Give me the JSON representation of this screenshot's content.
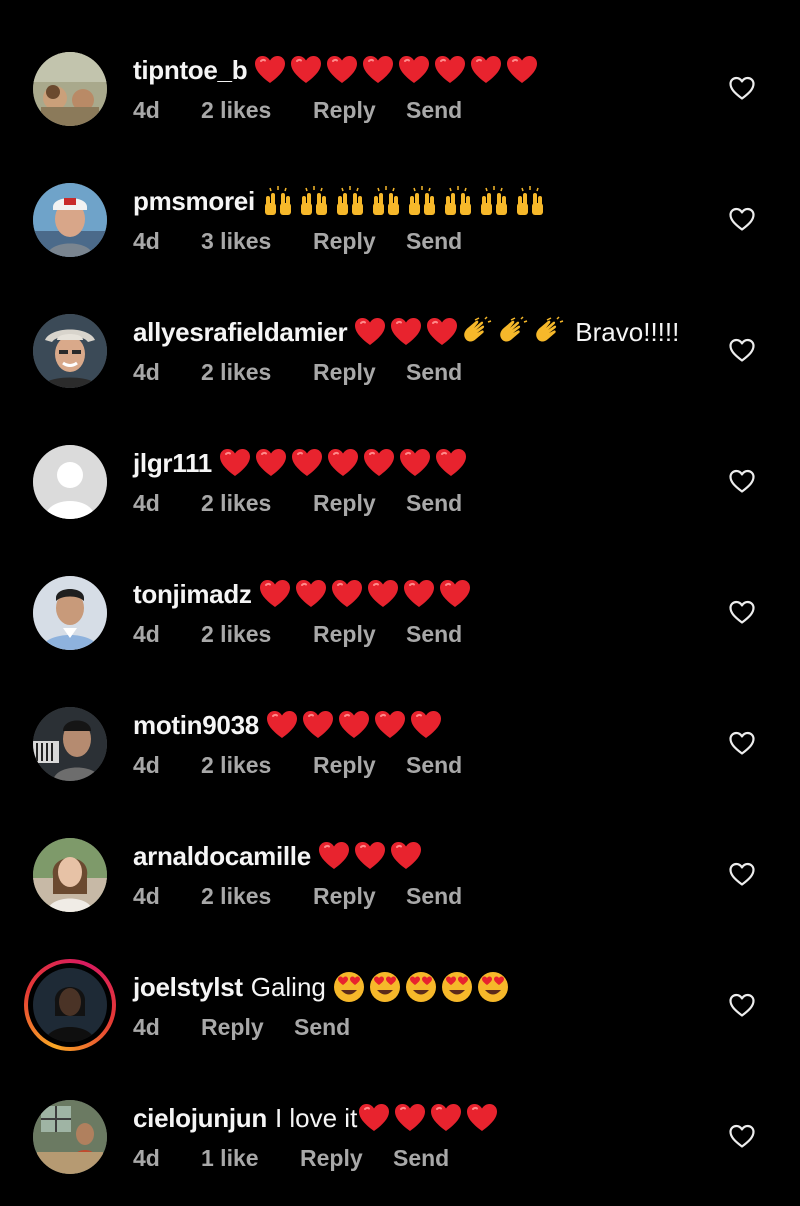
{
  "comments": [
    {
      "username": "tipntoe_b",
      "text": "",
      "emojis": [
        "heart",
        "heart",
        "heart",
        "heart",
        "heart",
        "heart",
        "heart",
        "heart"
      ],
      "trailing": "",
      "time": "4d",
      "likes": "2 likes",
      "reply": "Reply",
      "send": "Send",
      "avatar": "painting"
    },
    {
      "username": "pmsmorei",
      "text": "",
      "emojis": [
        "raising-hands",
        "raising-hands",
        "raising-hands",
        "raising-hands",
        "raising-hands",
        "raising-hands",
        "raising-hands",
        "raising-hands"
      ],
      "trailing": "",
      "time": "4d",
      "likes": "3 likes",
      "reply": "Reply",
      "send": "Send",
      "avatar": "cap-man"
    },
    {
      "username": "allyesrafieldamier",
      "text": "",
      "emojis": [
        "heart",
        "heart",
        "heart",
        "clapping-hands",
        "clapping-hands",
        "clapping-hands"
      ],
      "trailing": "Bravo!!!!!",
      "time": "4d",
      "likes": "2 likes",
      "reply": "Reply",
      "send": "Send",
      "avatar": "hat-man"
    },
    {
      "username": "jlgr111",
      "text": "",
      "emojis": [
        "heart",
        "heart",
        "heart",
        "heart",
        "heart",
        "heart",
        "heart"
      ],
      "trailing": "",
      "time": "4d",
      "likes": "2 likes",
      "reply": "Reply",
      "send": "Send",
      "avatar": "default"
    },
    {
      "username": "tonjimadz",
      "text": "",
      "emojis": [
        "heart",
        "heart",
        "heart",
        "heart",
        "heart",
        "heart"
      ],
      "trailing": "",
      "time": "4d",
      "likes": "2 likes",
      "reply": "Reply",
      "send": "Send",
      "avatar": "shirt-man"
    },
    {
      "username": "motin9038",
      "text": "",
      "emojis": [
        "heart",
        "heart",
        "heart",
        "heart",
        "heart"
      ],
      "trailing": "",
      "time": "4d",
      "likes": "2 likes",
      "reply": "Reply",
      "send": "Send",
      "avatar": "dark-man"
    },
    {
      "username": "arnaldocamille",
      "text": "",
      "emojis": [
        "heart",
        "heart",
        "heart"
      ],
      "trailing": "",
      "time": "4d",
      "likes": "2 likes",
      "reply": "Reply",
      "send": "Send",
      "avatar": "girl"
    },
    {
      "username": "joelstylst",
      "text": "Galing",
      "emojis": [
        "heart-eyes",
        "heart-eyes",
        "heart-eyes",
        "heart-eyes",
        "heart-eyes"
      ],
      "trailing": "",
      "time": "4d",
      "likes": "",
      "reply": "Reply",
      "send": "Send",
      "avatar": "story-woman"
    },
    {
      "username": "cielojunjun",
      "text": "I love it",
      "emojis": [
        "heart",
        "heart",
        "heart",
        "heart"
      ],
      "trailing": "",
      "time": "4d",
      "likes": "1 like",
      "reply": "Reply",
      "send": "Send",
      "avatar": "room"
    }
  ]
}
